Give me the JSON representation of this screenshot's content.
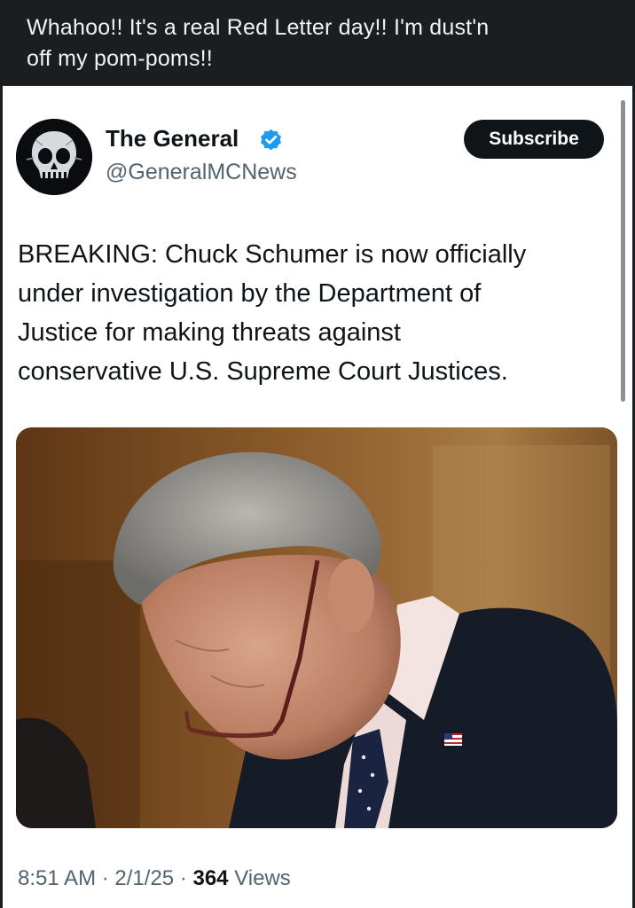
{
  "caption": {
    "line1": "Whahoo!! It's a real Red Letter day!! I'm dust'n",
    "line2": "off my pom-poms!!"
  },
  "tweet": {
    "author_name": "The General",
    "handle": "@GeneralMCNews",
    "verified_icon": "verified-badge-icon",
    "subscribe_label": "Subscribe",
    "text_lines": [
      "BREAKING: Chuck Schumer is now officially",
      "under investigation by the Department of",
      "Justice for making threats against",
      "conservative U.S. Supreme Court Justices."
    ],
    "time": "8:51 AM",
    "separator": "·",
    "date": "2/1/25",
    "views_count": "364",
    "views_label": "Views"
  },
  "colors": {
    "caption_background": "#1b1d21",
    "caption_text": "#f1f2f4",
    "card_background": "#ffffff",
    "verified_blue": "#1d9bf0",
    "subscribe_background": "#0f1419",
    "secondary_text": "#536471"
  }
}
